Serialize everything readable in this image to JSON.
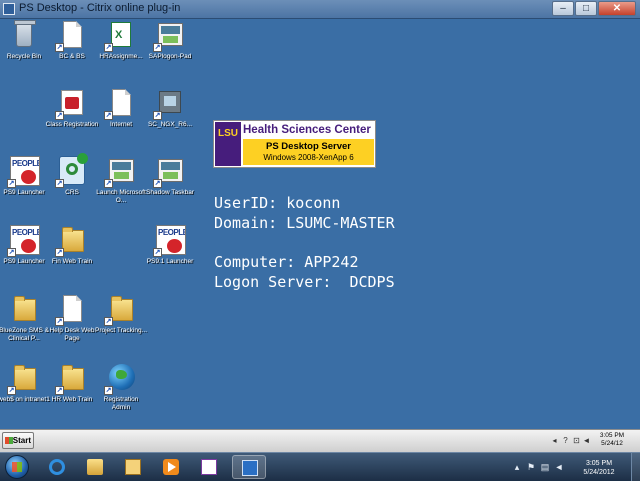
{
  "window": {
    "title": "PS Desktop - Citrix online plug-in",
    "ghost_title": "",
    "minimize_glyph": "–",
    "maximize_glyph": "□",
    "close_glyph": "✕"
  },
  "desktop_icons": [
    {
      "label": "Recycle Bin",
      "icon": "recycle-bin-icon"
    },
    {
      "label": "BC & BS",
      "icon": "document-icon"
    },
    {
      "label": "HRAssignme...",
      "icon": "excel-icon"
    },
    {
      "label": "SAPlogon-Pad",
      "icon": "app-window-icon"
    },
    {
      "label": "Class Registration",
      "icon": "class-registration-icon"
    },
    {
      "label": "Internet",
      "icon": "document-icon"
    },
    {
      "label": "SC_NGX_R6...",
      "icon": "network-icon"
    },
    {
      "label": "PS9 Launcher",
      "icon": "peoplesoft-icon"
    },
    {
      "label": "CRS",
      "icon": "crs-icon"
    },
    {
      "label": "Launch Microsoft O...",
      "icon": "app-window-icon"
    },
    {
      "label": "Shadow Taskbar",
      "icon": "app-window-icon"
    },
    {
      "label": "PS9 Launcher",
      "icon": "peoplesoft-icon"
    },
    {
      "label": "Fin Web Train",
      "icon": "folder-icon"
    },
    {
      "label": "PS9.1 Launcher",
      "icon": "peoplesoft-icon"
    },
    {
      "label": "BlueZone SMS & Clinical P...",
      "icon": "folder-icon"
    },
    {
      "label": "Help Desk Web Page",
      "icon": "document-icon"
    },
    {
      "label": "Project Tracking...",
      "icon": "folder-icon"
    },
    {
      "label": "web$ on intranet1",
      "icon": "folder-icon"
    },
    {
      "label": "HR Web Train",
      "icon": "folder-icon"
    },
    {
      "label": "Registration Admin",
      "icon": "globe-icon"
    }
  ],
  "banner": {
    "logo": "LSU",
    "org": "Health Sciences Center",
    "server": "PS Desktop Server",
    "platform": "Windows 2008-XenApp 6"
  },
  "session": {
    "userid": "UserID: koconn",
    "domain": "Domain: LSUMC-MASTER",
    "computer": "Computer: APP242",
    "logon_server": "Logon Server:  DCDPS"
  },
  "citrix_taskbar": {
    "start_label": "Start",
    "time": "3:05 PM",
    "date": "5/24/12"
  },
  "windows_taskbar": {
    "time": "3:05 PM",
    "date": "5/24/2012"
  },
  "colors": {
    "desktop": "#3a6ea5",
    "lsu_purple": "#461d7c",
    "lsu_gold": "#fdd023"
  }
}
